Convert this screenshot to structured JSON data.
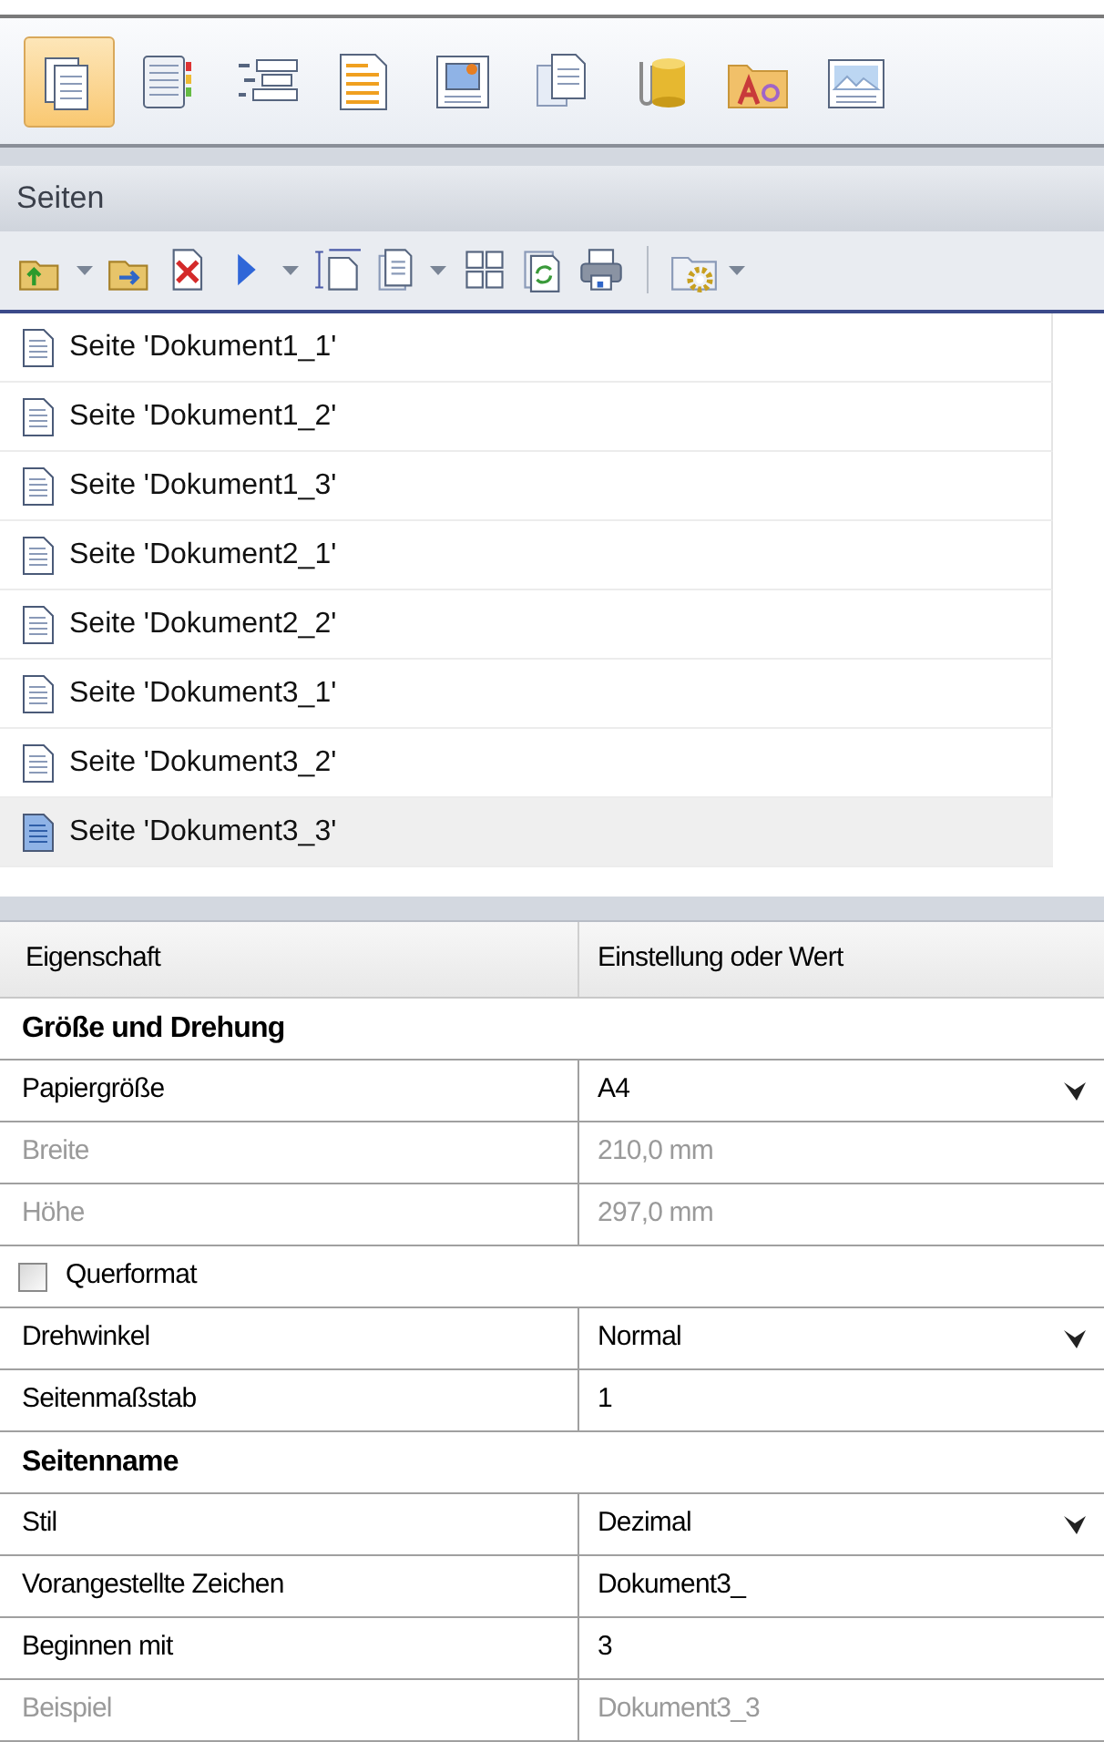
{
  "view_toolbar": [
    {
      "selected": true
    },
    {
      "selected": false
    },
    {
      "selected": false
    },
    {
      "selected": false
    },
    {
      "selected": false
    },
    {
      "selected": false
    },
    {
      "selected": false
    },
    {
      "selected": false
    },
    {
      "selected": false
    }
  ],
  "pages_panel": {
    "title": "Seiten",
    "toolbar": [
      {
        "kind": "split"
      },
      {
        "kind": "button"
      },
      {
        "kind": "button"
      },
      {
        "kind": "split"
      },
      {
        "kind": "button"
      },
      {
        "kind": "split"
      },
      {
        "kind": "button"
      },
      {
        "kind": "button"
      },
      {
        "kind": "button"
      },
      {
        "kind": "separator"
      },
      {
        "kind": "split"
      }
    ],
    "pages": [
      {
        "label": "Seite 'Dokument1_1'",
        "selected": false
      },
      {
        "label": "Seite 'Dokument1_2'",
        "selected": false
      },
      {
        "label": "Seite 'Dokument1_3'",
        "selected": false
      },
      {
        "label": "Seite 'Dokument2_1'",
        "selected": false
      },
      {
        "label": "Seite 'Dokument2_2'",
        "selected": false
      },
      {
        "label": "Seite 'Dokument3_1'",
        "selected": false
      },
      {
        "label": "Seite 'Dokument3_2'",
        "selected": false
      },
      {
        "label": "Seite 'Dokument3_3'",
        "selected": true
      }
    ]
  },
  "properties": {
    "columns": [
      "Eigenschaft",
      "Einstellung oder Wert"
    ],
    "rows": [
      {
        "kind": "section",
        "label": "Größe und Drehung"
      },
      {
        "kind": "property",
        "label": "Papiergröße",
        "value": "A4",
        "disabled": false,
        "dropdown": true
      },
      {
        "kind": "property",
        "label": "Breite",
        "value": "210,0 mm",
        "disabled": true,
        "dropdown": false
      },
      {
        "kind": "property",
        "label": "Höhe",
        "value": "297,0 mm",
        "disabled": true,
        "dropdown": false
      },
      {
        "kind": "checkbox",
        "label": "Querformat",
        "checked": false
      },
      {
        "kind": "property",
        "label": "Drehwinkel",
        "value": "Normal",
        "disabled": false,
        "dropdown": true
      },
      {
        "kind": "property",
        "label": "Seitenmaßstab",
        "value": "1",
        "disabled": false,
        "dropdown": false
      },
      {
        "kind": "section",
        "label": "Seitenname"
      },
      {
        "kind": "property",
        "label": "Stil",
        "value": "Dezimal",
        "disabled": false,
        "dropdown": true
      },
      {
        "kind": "property",
        "label": "Vorangestellte Zeichen",
        "value": "Dokument3_",
        "disabled": false,
        "dropdown": false
      },
      {
        "kind": "property",
        "label": "Beginnen mit",
        "value": "3",
        "disabled": false,
        "dropdown": false
      },
      {
        "kind": "property",
        "label": "Beispiel",
        "value": "Dokument3_3",
        "disabled": true,
        "dropdown": false
      }
    ]
  }
}
